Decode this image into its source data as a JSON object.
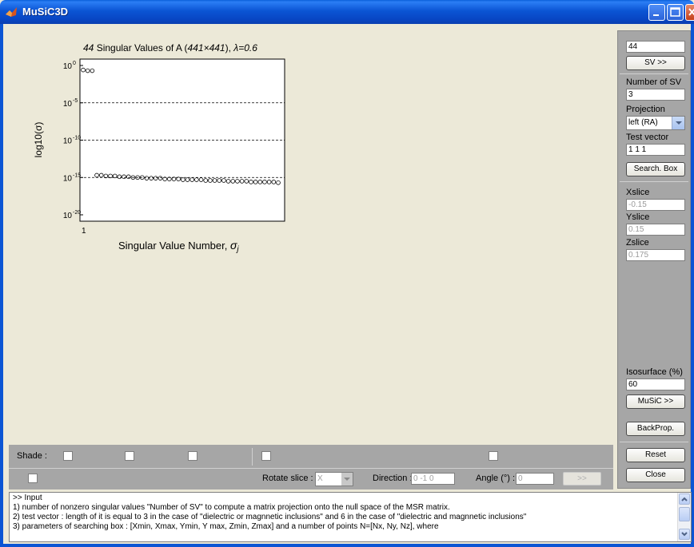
{
  "window": {
    "title": "MuSiC3D"
  },
  "chart_data": {
    "type": "scatter",
    "title_count": "44",
    "title_mid": " Singular Values of A (",
    "title_dims": "441×441",
    "title_after": "),  ",
    "title_lambda": "λ=0.6",
    "xlabel": "Singular Value Number, ",
    "xlabel_sym": "σ",
    "xlabel_sub": "j",
    "ylabel": "log10(σ)",
    "x_tick": "1",
    "ylim": [
      -20,
      0
    ],
    "y_ticks": [
      0,
      -5,
      -10,
      -15,
      -20
    ],
    "y_tick_labels": [
      "10",
      "10",
      "10",
      "10",
      "10"
    ],
    "y_tick_exps": [
      "0",
      "-5",
      "-10",
      "-15",
      "-20"
    ],
    "gridlines_at": [
      -5,
      -10,
      -15
    ],
    "x_range": [
      1,
      44
    ],
    "points": [
      {
        "x": 1,
        "y": -0.6
      },
      {
        "x": 2,
        "y": -0.7
      },
      {
        "x": 3,
        "y": -0.7
      },
      {
        "x": 4,
        "y": -14.7
      },
      {
        "x": 5,
        "y": -14.7
      },
      {
        "x": 6,
        "y": -14.8
      },
      {
        "x": 7,
        "y": -14.8
      },
      {
        "x": 8,
        "y": -14.8
      },
      {
        "x": 9,
        "y": -14.9
      },
      {
        "x": 10,
        "y": -14.9
      },
      {
        "x": 11,
        "y": -14.9
      },
      {
        "x": 12,
        "y": -15.0
      },
      {
        "x": 13,
        "y": -15.0
      },
      {
        "x": 14,
        "y": -15.0
      },
      {
        "x": 15,
        "y": -15.1
      },
      {
        "x": 16,
        "y": -15.1
      },
      {
        "x": 17,
        "y": -15.1
      },
      {
        "x": 18,
        "y": -15.1
      },
      {
        "x": 19,
        "y": -15.2
      },
      {
        "x": 20,
        "y": -15.2
      },
      {
        "x": 21,
        "y": -15.2
      },
      {
        "x": 22,
        "y": -15.2
      },
      {
        "x": 23,
        "y": -15.3
      },
      {
        "x": 24,
        "y": -15.3
      },
      {
        "x": 25,
        "y": -15.3
      },
      {
        "x": 26,
        "y": -15.3
      },
      {
        "x": 27,
        "y": -15.3
      },
      {
        "x": 28,
        "y": -15.4
      },
      {
        "x": 29,
        "y": -15.4
      },
      {
        "x": 30,
        "y": -15.4
      },
      {
        "x": 31,
        "y": -15.4
      },
      {
        "x": 32,
        "y": -15.4
      },
      {
        "x": 33,
        "y": -15.5
      },
      {
        "x": 34,
        "y": -15.5
      },
      {
        "x": 35,
        "y": -15.5
      },
      {
        "x": 36,
        "y": -15.5
      },
      {
        "x": 37,
        "y": -15.5
      },
      {
        "x": 38,
        "y": -15.6
      },
      {
        "x": 39,
        "y": -15.6
      },
      {
        "x": 40,
        "y": -15.6
      },
      {
        "x": 41,
        "y": -15.6
      },
      {
        "x": 42,
        "y": -15.6
      },
      {
        "x": 43,
        "y": -15.6
      },
      {
        "x": 44,
        "y": -15.7
      }
    ]
  },
  "side": {
    "sv_value": "44",
    "sv_button": "SV >>",
    "num_sv_label": "Number of SV",
    "num_sv_value": "3",
    "projection_label": "Projection",
    "projection_value": "left (RA)",
    "test_vector_label": "Test vector",
    "test_vector_value": "1 1 1",
    "search_box_button": "Search. Box",
    "xslice_label": "Xslice",
    "xslice_value": "-0.15",
    "yslice_label": "Yslice",
    "yslice_value": "0.15",
    "zslice_label": "Zslice",
    "zslice_value": "0.175",
    "isosurface_label": "Isosurface (%)",
    "isosurface_value": "60",
    "music_button": "MuSiC >>",
    "backprop_button": "BackProp.",
    "reset_button": "Reset",
    "close_button": "Close"
  },
  "bottom": {
    "shade_label": "Shade :",
    "rotate_label": "Rotate slice :",
    "rotate_value": "X",
    "direction_label": "Direction :",
    "direction_value": "0 -1 0",
    "angle_label": "Angle (°) :",
    "angle_value": "0",
    "apply_button": ">>"
  },
  "console": {
    "lines": [
      ">> Input",
      "   1) number of nonzero singular values \"Number of SV\" to compute a matrix projection onto the null space of the MSR matrix.",
      "   2) test vector : length of it is equal to 3 in the case of \"dielectric or magnnetic inclusions\" and 6 in the case of \"dielectric and magnnetic inclusions\"",
      "   3) parameters of searching box : [Xmin, Xmax, Ymin, Y max, Zmin, Zmax] and a number of points N=[Nx, Ny, Nz], where"
    ]
  }
}
